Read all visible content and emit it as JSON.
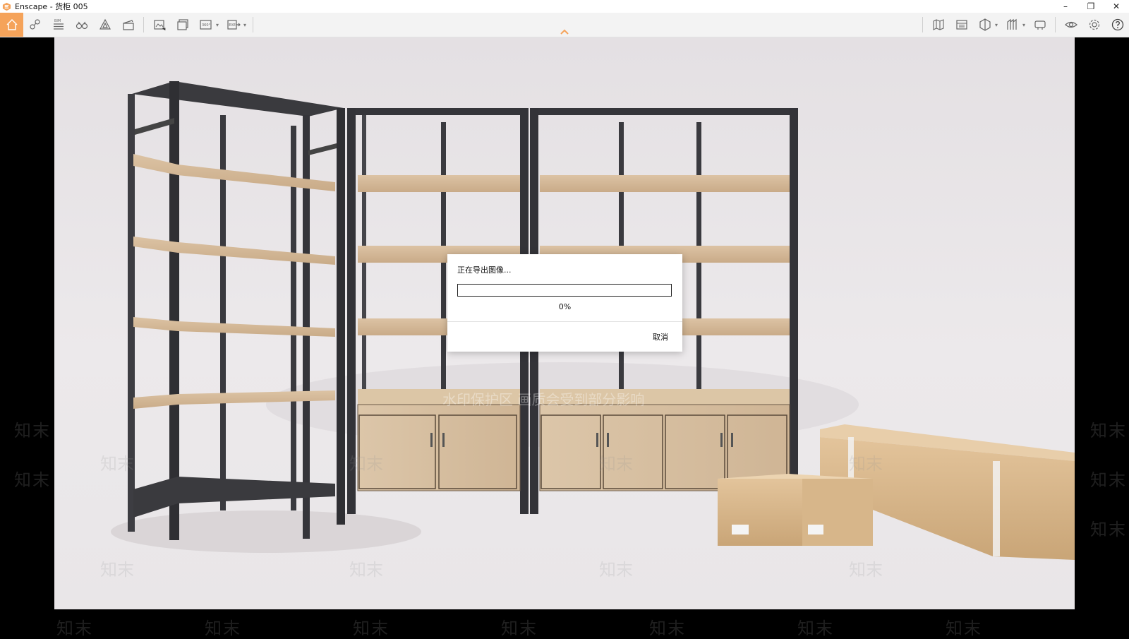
{
  "window": {
    "title": "Enscape - 货柜 005",
    "logo_icon": "enscape-logo-icon",
    "controls": {
      "minimize": "–",
      "maximize": "❐",
      "close": "✕"
    }
  },
  "toolbar": {
    "accent_color": "#f5a35a",
    "left_icons": [
      "home-icon",
      "map-pin-icon",
      "bim-icon",
      "binoculars-icon",
      "asset-library-icon",
      "video-editor-icon",
      "render-image-icon",
      "batch-render-icon",
      "panorama-360-icon",
      "export-exe-icon"
    ],
    "bim_label": "BIM",
    "panorama_label": "360°",
    "exe_label": "EXE",
    "right_icons": [
      "map-view-icon",
      "views-icon",
      "section-icon",
      "material-icon",
      "vr-headset-icon",
      "visibility-icon",
      "settings-icon",
      "help-icon"
    ]
  },
  "watermark": {
    "banner": "水印保护区   画质会受到部分影响",
    "brand": "知末"
  },
  "dialog": {
    "title": "正在导出图像...",
    "progress": 0,
    "percent_label": "0%",
    "cancel_label": "取消"
  }
}
